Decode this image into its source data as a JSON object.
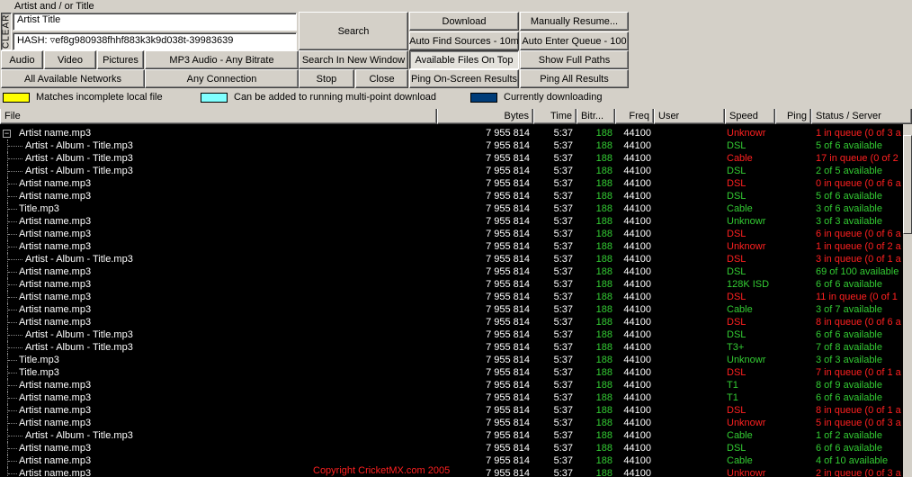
{
  "search": {
    "label": "Artist and / or Title",
    "clear_label": "CLEAR",
    "query_value": "Artist Title",
    "hash_value": "HASH: ▿ef8g980938fhhf883k3k9d038t-39983639",
    "search_label": "Search",
    "search_new_window_label": "Search In New Window"
  },
  "filters": {
    "audio": "Audio",
    "video": "Video",
    "pictures": "Pictures",
    "format": "MP3 Audio - Any Bitrate",
    "networks": "All Available Networks",
    "connection": "Any Connection",
    "stop": "Stop",
    "close": "Close"
  },
  "actions": {
    "download": "Download",
    "manual_resume": "Manually Resume...",
    "auto_find": "Auto Find Sources - 10m",
    "auto_enter": "Auto Enter Queue - 100",
    "available_on_top": "Available Files On Top",
    "show_full_paths": "Show Full Paths",
    "ping_onscreen": "Ping On-Screen Results",
    "ping_all": "Ping All Results"
  },
  "legend": {
    "items": [
      {
        "label": "Matches incomplete local file",
        "color": "#ffff00"
      },
      {
        "label": "Can be added to running multi-point download",
        "color": "#80ffff"
      },
      {
        "label": "Currently downloading",
        "color": "#003c78"
      }
    ]
  },
  "columns": [
    "File",
    "Bytes",
    "Time",
    "Bitr...",
    "Freq",
    "User",
    "Speed",
    "Ping",
    "Status / Server"
  ],
  "colors": {
    "available": "#33cc33",
    "queued": "#ff2020",
    "copyright": "#ff2020"
  },
  "rows": [
    {
      "file": "Artist name.mp3",
      "bytes": "7 955 814",
      "time": "5:37",
      "bitrate": "188",
      "freq": "44100",
      "user": "",
      "speed": "Unknowr",
      "status": "1 in queue (0 of 3 a",
      "level": 0,
      "avail": false,
      "parent": true
    },
    {
      "file": "Artist - Album - Title.mp3",
      "bytes": "7 955 814",
      "time": "5:37",
      "bitrate": "188",
      "freq": "44100",
      "user": "",
      "speed": "DSL",
      "status": "5 of 6 available",
      "level": 1,
      "avail": true
    },
    {
      "file": "Artist - Album - Title.mp3",
      "bytes": "7 955 814",
      "time": "5:37",
      "bitrate": "188",
      "freq": "44100",
      "user": "",
      "speed": "Cable",
      "status": "17 in queue (0 of 2",
      "level": 1,
      "avail": false
    },
    {
      "file": "Artist - Album - Title.mp3",
      "bytes": "7 955 814",
      "time": "5:37",
      "bitrate": "188",
      "freq": "44100",
      "user": "",
      "speed": "DSL",
      "status": "2 of 5 available",
      "level": 1,
      "avail": true
    },
    {
      "file": "Artist name.mp3",
      "bytes": "7 955 814",
      "time": "5:37",
      "bitrate": "188",
      "freq": "44100",
      "user": "",
      "speed": "DSL",
      "status": "0 in queue (0 of 6 a",
      "level": 0,
      "avail": false
    },
    {
      "file": "Artist name.mp3",
      "bytes": "7 955 814",
      "time": "5:37",
      "bitrate": "188",
      "freq": "44100",
      "user": "",
      "speed": "DSL",
      "status": "5 of 6 available",
      "level": 0,
      "avail": true
    },
    {
      "file": "Title.mp3",
      "bytes": "7 955 814",
      "time": "5:37",
      "bitrate": "188",
      "freq": "44100",
      "user": "",
      "speed": "Cable",
      "status": "3 of 6 available",
      "level": 0,
      "avail": true
    },
    {
      "file": "Artist name.mp3",
      "bytes": "7 955 814",
      "time": "5:37",
      "bitrate": "188",
      "freq": "44100",
      "user": "",
      "speed": "Unknowr",
      "status": "3 of 3 available",
      "level": 0,
      "avail": true
    },
    {
      "file": "Artist name.mp3",
      "bytes": "7 955 814",
      "time": "5:37",
      "bitrate": "188",
      "freq": "44100",
      "user": "",
      "speed": "DSL",
      "status": "6 in queue (0 of 6 a",
      "level": 0,
      "avail": false
    },
    {
      "file": "Artist name.mp3",
      "bytes": "7 955 814",
      "time": "5:37",
      "bitrate": "188",
      "freq": "44100",
      "user": "",
      "speed": "Unknowr",
      "status": "1 in queue (0 of 2 a",
      "level": 0,
      "avail": false
    },
    {
      "file": "Artist - Album - Title.mp3",
      "bytes": "7 955 814",
      "time": "5:37",
      "bitrate": "188",
      "freq": "44100",
      "user": "",
      "speed": "DSL",
      "status": "3 in queue (0 of 1 a",
      "level": 1,
      "avail": false
    },
    {
      "file": "Artist name.mp3",
      "bytes": "7 955 814",
      "time": "5:37",
      "bitrate": "188",
      "freq": "44100",
      "user": "",
      "speed": "DSL",
      "status": "69 of 100 available",
      "level": 0,
      "avail": true
    },
    {
      "file": "Artist name.mp3",
      "bytes": "7 955 814",
      "time": "5:37",
      "bitrate": "188",
      "freq": "44100",
      "user": "",
      "speed": "128K ISD",
      "status": "6 of 6 available",
      "level": 0,
      "avail": true
    },
    {
      "file": "Artist name.mp3",
      "bytes": "7 955 814",
      "time": "5:37",
      "bitrate": "188",
      "freq": "44100",
      "user": "",
      "speed": "DSL",
      "status": "11 in queue (0 of 1",
      "level": 0,
      "avail": false
    },
    {
      "file": "Artist name.mp3",
      "bytes": "7 955 814",
      "time": "5:37",
      "bitrate": "188",
      "freq": "44100",
      "user": "",
      "speed": "Cable",
      "status": "3 of 7 available",
      "level": 0,
      "avail": true
    },
    {
      "file": "Artist name.mp3",
      "bytes": "7 955 814",
      "time": "5:37",
      "bitrate": "188",
      "freq": "44100",
      "user": "",
      "speed": "DSL",
      "status": "8 in queue (0 of 6 a",
      "level": 0,
      "avail": false
    },
    {
      "file": "Artist - Album - Title.mp3",
      "bytes": "7 955 814",
      "time": "5:37",
      "bitrate": "188",
      "freq": "44100",
      "user": "",
      "speed": "DSL",
      "status": "6 of 6 available",
      "level": 1,
      "avail": true
    },
    {
      "file": "Artist - Album - Title.mp3",
      "bytes": "7 955 814",
      "time": "5:37",
      "bitrate": "188",
      "freq": "44100",
      "user": "",
      "speed": "T3+",
      "status": "7 of 8 available",
      "level": 1,
      "avail": true
    },
    {
      "file": "Title.mp3",
      "bytes": "7 955 814",
      "time": "5:37",
      "bitrate": "188",
      "freq": "44100",
      "user": "",
      "speed": "Unknowr",
      "status": "3 of 3 available",
      "level": 0,
      "avail": true
    },
    {
      "file": "Title.mp3",
      "bytes": "7 955 814",
      "time": "5:37",
      "bitrate": "188",
      "freq": "44100",
      "user": "",
      "speed": "DSL",
      "status": "7 in queue (0 of 1 a",
      "level": 0,
      "avail": false
    },
    {
      "file": "Artist name.mp3",
      "bytes": "7 955 814",
      "time": "5:37",
      "bitrate": "188",
      "freq": "44100",
      "user": "",
      "speed": "T1",
      "status": "8 of 9 available",
      "level": 0,
      "avail": true
    },
    {
      "file": "Artist name.mp3",
      "bytes": "7 955 814",
      "time": "5:37",
      "bitrate": "188",
      "freq": "44100",
      "user": "",
      "speed": "T1",
      "status": "6 of 6 available",
      "level": 0,
      "avail": true
    },
    {
      "file": "Artist name.mp3",
      "bytes": "7 955 814",
      "time": "5:37",
      "bitrate": "188",
      "freq": "44100",
      "user": "",
      "speed": "DSL",
      "status": "8 in queue (0 of 1 a",
      "level": 0,
      "avail": false
    },
    {
      "file": "Artist name.mp3",
      "bytes": "7 955 814",
      "time": "5:37",
      "bitrate": "188",
      "freq": "44100",
      "user": "",
      "speed": "Unknowr",
      "status": "5 in queue (0 of 3 a",
      "level": 0,
      "avail": false
    },
    {
      "file": "Artist - Album - Title.mp3",
      "bytes": "7 955 814",
      "time": "5:37",
      "bitrate": "188",
      "freq": "44100",
      "user": "",
      "speed": "Cable",
      "status": "1 of 2 available",
      "level": 1,
      "avail": true
    },
    {
      "file": "Artist name.mp3",
      "bytes": "7 955 814",
      "time": "5:37",
      "bitrate": "188",
      "freq": "44100",
      "user": "",
      "speed": "DSL",
      "status": "6 of 6 available",
      "level": 0,
      "avail": true
    },
    {
      "file": "Artist name.mp3",
      "bytes": "7 955 814",
      "time": "5:37",
      "bitrate": "188",
      "freq": "44100",
      "user": "",
      "speed": "Cable",
      "status": "4 of 10 available",
      "level": 0,
      "avail": true
    },
    {
      "file": "Artist name.mp3",
      "bytes": "7 955 814",
      "time": "5:37",
      "bitrate": "188",
      "freq": "44100",
      "user": "",
      "speed": "Unknowr",
      "status": "2 in queue (0 of 3 a",
      "level": 0,
      "avail": false
    }
  ],
  "copyright": "Copyright CricketMX.com 2005"
}
